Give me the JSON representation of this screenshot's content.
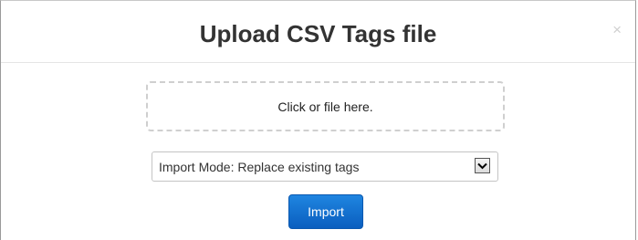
{
  "dialog": {
    "title": "Upload CSV Tags file",
    "close_label": "×"
  },
  "dropzone": {
    "text": "Click or file here."
  },
  "import_mode": {
    "selected": "Import Mode: Replace existing tags",
    "arrow_icon": "chevron-down-icon"
  },
  "actions": {
    "import_label": "Import"
  },
  "colors": {
    "primary_button": "#1a73d1",
    "title_text": "#333333"
  }
}
